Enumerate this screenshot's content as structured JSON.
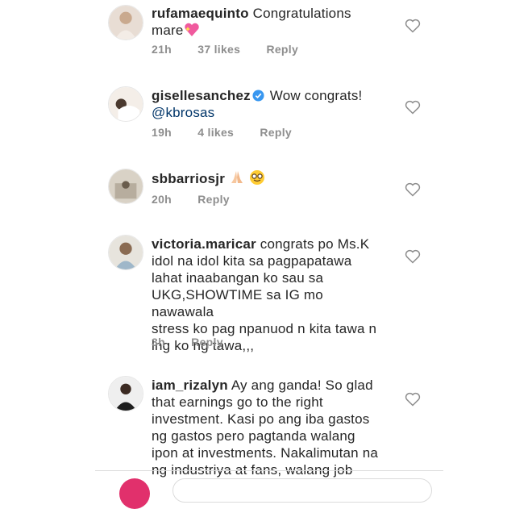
{
  "comments": [
    {
      "username": "rufamaequinto",
      "text": "Congratulations",
      "text2": "mare",
      "time": "21h",
      "likes": "37 likes",
      "reply": "Reply"
    },
    {
      "username": "gisellesanchez",
      "text": "Wow congrats!",
      "mention": "@kbrosas",
      "time": "19h",
      "likes": "4 likes",
      "reply": "Reply"
    },
    {
      "username": "sbbarriosjr",
      "time": "20h",
      "reply": "Reply"
    },
    {
      "username": "victoria.maricar",
      "text": "congrats po Ms.K",
      "lines": [
        "idol na idol kita sa pagpapatawa",
        "lahat inaabangan ko sau sa",
        "UKG,SHOWTIME sa IG mo nawawala",
        "stress ko pag npanuod n kita tawa n",
        "lng ko ng tawa,,,"
      ],
      "time": "3h",
      "reply": "Reply"
    },
    {
      "username": "iam_rizalyn",
      "text": "Ay ang ganda! So glad",
      "lines": [
        "that earnings go to the right",
        "investment. Kasi po ang iba gastos",
        "ng gastos pero pagtanda walang",
        "ipon at investments. Nakalimutan na",
        "ng industriya at fans, walang job"
      ]
    }
  ],
  "colors": {
    "text": "#262626",
    "meta": "#8e8e8e",
    "mention": "#003569",
    "verified": "#3897f0",
    "accent": "#e1306c"
  }
}
